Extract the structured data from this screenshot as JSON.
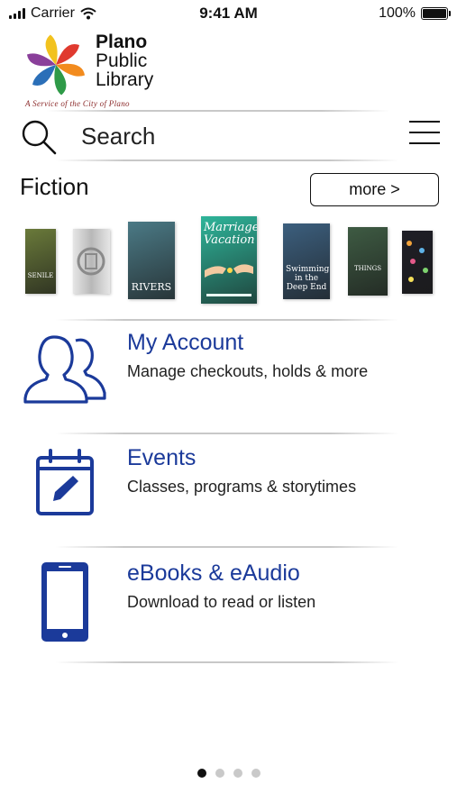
{
  "status_bar": {
    "carrier": "Carrier",
    "time": "9:41 AM",
    "battery": "100%",
    "battery_level": 1.0
  },
  "logo": {
    "line1": "Plano",
    "line2": "Public",
    "line3": "Library",
    "tagline": "A Service of the City of Plano",
    "colors": [
      "#e03a2f",
      "#f28b1e",
      "#2e9a48",
      "#2b6fb8",
      "#8a3f9a",
      "#f2c21e"
    ]
  },
  "search": {
    "icon": "search-icon",
    "placeholder": "Search",
    "value": ""
  },
  "menu": {
    "icon": "hamburger-menu-icon"
  },
  "fiction": {
    "title": "Fiction",
    "more_label": "more >",
    "books": [
      {
        "cover_text": "SENILE",
        "color": "#6a7a3a"
      },
      {
        "cover_text": "",
        "color": "#b8b8b8"
      },
      {
        "cover_text": "RIVERS",
        "color": "#4b7a86"
      },
      {
        "cover_text": "Marriage Vacation",
        "color": "#2eb59a"
      },
      {
        "cover_text": "Swimming in the Deep End",
        "color": "#3c5f7e"
      },
      {
        "cover_text": "THINGS",
        "color": "#3e5b43"
      },
      {
        "cover_text": "",
        "color": "#1e1e26"
      }
    ]
  },
  "items": [
    {
      "title": "My Account",
      "subtitle": "Manage checkouts, holds & more",
      "icon": "users-icon"
    },
    {
      "title": "Events",
      "subtitle": "Classes, programs & storytimes",
      "icon": "calendar-edit-icon"
    },
    {
      "title": "eBooks & eAudio",
      "subtitle": "Download to read or listen",
      "icon": "phone-device-icon"
    }
  ],
  "accent_color": "#1b3a9a",
  "pagination": {
    "pages": 4,
    "current": 1
  }
}
